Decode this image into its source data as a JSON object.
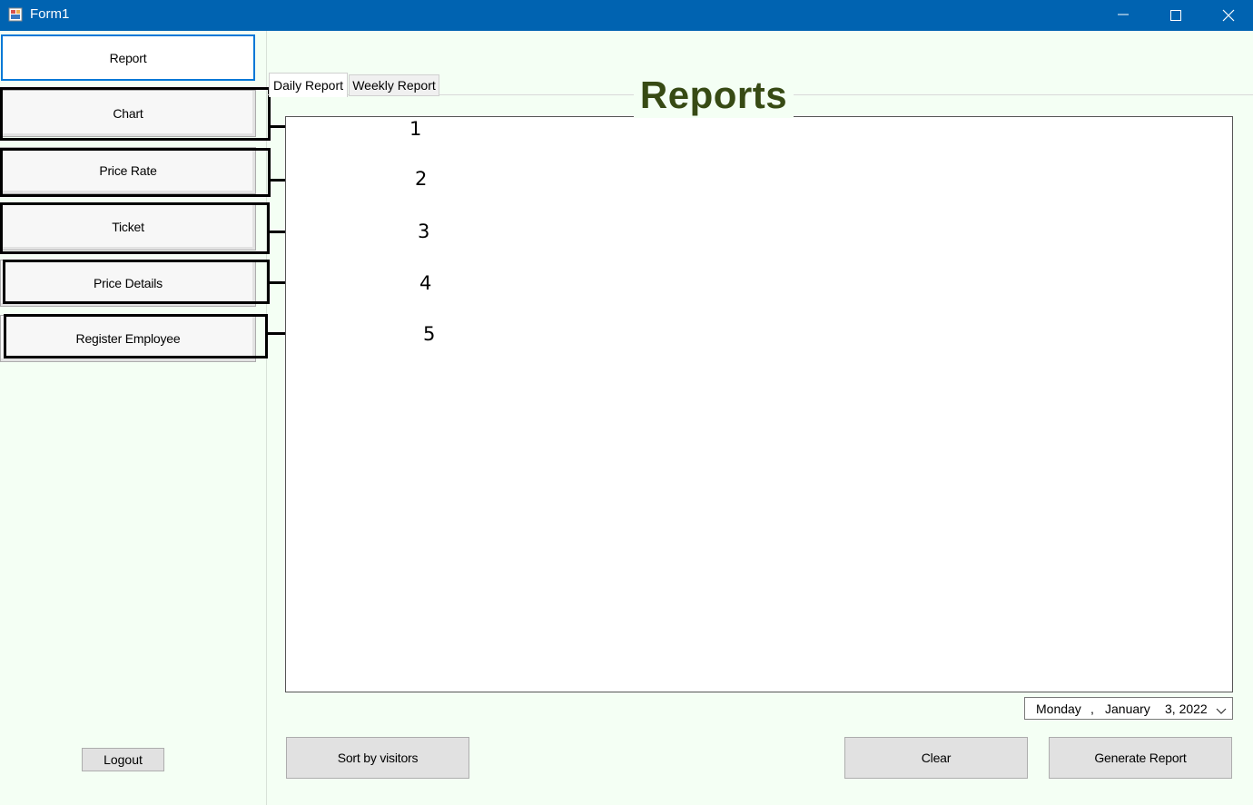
{
  "window": {
    "title": "Form1"
  },
  "sidebar": {
    "items": [
      {
        "label": "Report"
      },
      {
        "label": "Chart"
      },
      {
        "label": "Price Rate"
      },
      {
        "label": "Ticket"
      },
      {
        "label": "Price Details"
      },
      {
        "label": "Register Employee"
      }
    ],
    "logout_label": "Logout"
  },
  "annotations": [
    "1",
    "2",
    "3",
    "4",
    "5"
  ],
  "main": {
    "heading": "Reports",
    "tabs": [
      {
        "label": "Daily Report"
      },
      {
        "label": "Weekly Report"
      }
    ],
    "date_picker": {
      "day": "Monday",
      "separator": ",",
      "month": "January",
      "date": "3, 2022"
    },
    "buttons": {
      "sort": "Sort by visitors",
      "clear": "Clear",
      "generate": "Generate Report"
    }
  },
  "colors": {
    "titlebar": "#0063b1",
    "background": "#f4fff4",
    "heading": "#374a14",
    "active_border": "#0078d7"
  }
}
